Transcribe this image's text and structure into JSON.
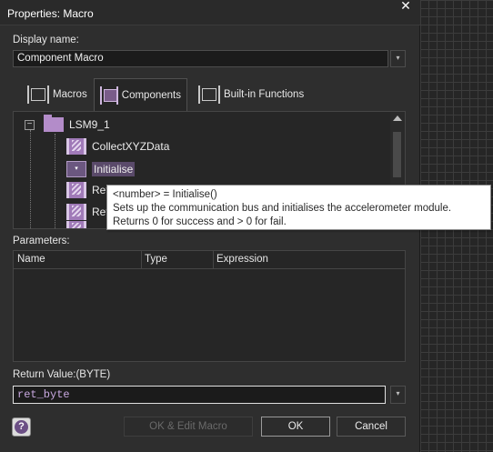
{
  "window": {
    "title": "Properties: Macro",
    "close_glyph": "✕"
  },
  "display_name": {
    "label": "Display name:",
    "value": "Component Macro"
  },
  "tabs": [
    {
      "label": "Macros",
      "icon": "macro-icon"
    },
    {
      "label": "Components",
      "icon": "component-icon"
    },
    {
      "label": "Built-in Functions",
      "icon": "builtin-function-icon"
    }
  ],
  "tree": {
    "root": {
      "label": "LSM9_1",
      "expander": "−"
    },
    "items": [
      {
        "label": "CollectXYZData"
      },
      {
        "label": "Initialise",
        "selected": true,
        "dropdown_glyph": "▾"
      },
      {
        "label": "Ret"
      },
      {
        "label": "Ret"
      },
      {
        "label": ""
      }
    ]
  },
  "tooltip": {
    "line1": "<number> = Initialise()",
    "line2": "Sets up the communication bus and initialises the accelerometer module.",
    "line3": "Returns 0 for success and > 0 for fail."
  },
  "parameters": {
    "label": "Parameters:",
    "columns": [
      "Name",
      "Type",
      "Expression"
    ],
    "rows": []
  },
  "return_value": {
    "label": "Return Value:(BYTE)",
    "value": "ret_byte"
  },
  "buttons": {
    "ok_edit": "OK & Edit Macro",
    "ok": "OK",
    "cancel": "Cancel",
    "help_glyph": "?"
  },
  "dropdown_glyph": "▾"
}
